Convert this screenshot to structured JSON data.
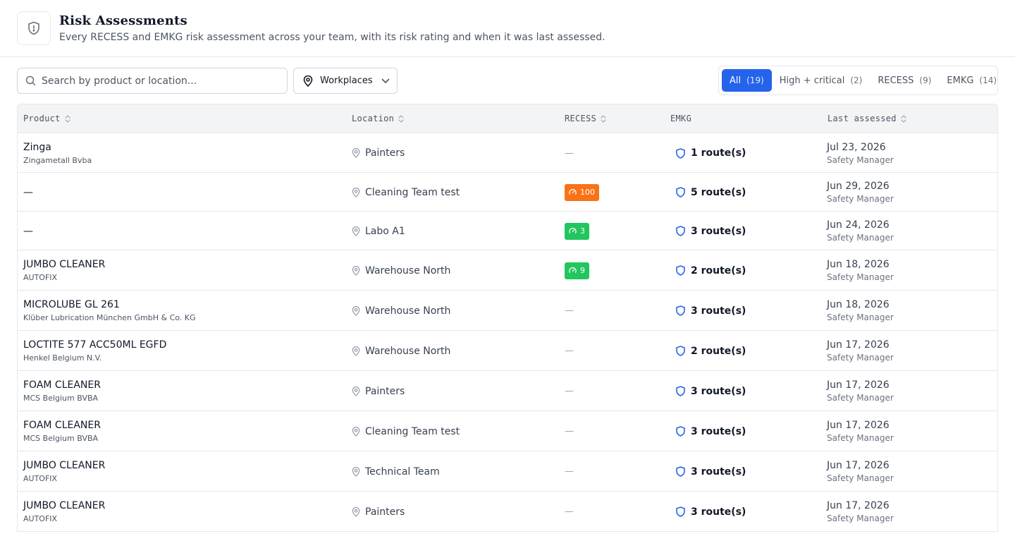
{
  "header": {
    "title": "Risk Assessments",
    "subtitle": "Every RECESS and EMKG risk assessment across your team, with its risk rating and when it was last assessed.",
    "icon": "shield-icon"
  },
  "toolbar": {
    "search_placeholder": "Search by product or location...",
    "workplaces_label": "Workplaces",
    "filters": [
      {
        "label": "All",
        "count": "(19)",
        "active": true
      },
      {
        "label": "High + critical",
        "count": "(2)",
        "active": false
      },
      {
        "label": "RECESS",
        "count": "(9)",
        "active": false
      },
      {
        "label": "EMKG",
        "count": "(14)",
        "active": false
      }
    ]
  },
  "table": {
    "columns": [
      "Product",
      "Location",
      "RECESS",
      "EMKG",
      "Last assessed"
    ],
    "rows": [
      {
        "product": "Zinga",
        "manufacturer": "Zingametall Bvba",
        "location": "Painters",
        "recess": null,
        "recess_color": null,
        "emkg": "1 route(s)",
        "date": "Jul 23, 2026",
        "assessor": "Safety Manager"
      },
      {
        "product": "—",
        "manufacturer": "",
        "location": "Cleaning Team test",
        "recess": "100",
        "recess_color": "#f97316",
        "emkg": "5 route(s)",
        "date": "Jun 29, 2026",
        "assessor": "Safety Manager"
      },
      {
        "product": "—",
        "manufacturer": "",
        "location": "Labo A1",
        "recess": "3",
        "recess_color": "#22c55e",
        "emkg": "3 route(s)",
        "date": "Jun 24, 2026",
        "assessor": "Safety Manager"
      },
      {
        "product": "JUMBO CLEANER",
        "manufacturer": "AUTOFIX",
        "location": "Warehouse North",
        "recess": "9",
        "recess_color": "#22c55e",
        "emkg": "2 route(s)",
        "date": "Jun 18, 2026",
        "assessor": "Safety Manager"
      },
      {
        "product": "MICROLUBE GL 261",
        "manufacturer": "Klüber Lubrication München GmbH & Co. KG",
        "location": "Warehouse North",
        "recess": null,
        "recess_color": null,
        "emkg": "3 route(s)",
        "date": "Jun 18, 2026",
        "assessor": "Safety Manager"
      },
      {
        "product": "LOCTITE 577 ACC50ML EGFD",
        "manufacturer": "Henkel Belgium N.V.",
        "location": "Warehouse North",
        "recess": null,
        "recess_color": null,
        "emkg": "2 route(s)",
        "date": "Jun 17, 2026",
        "assessor": "Safety Manager"
      },
      {
        "product": "FOAM CLEANER",
        "manufacturer": "MCS Belgium BVBA",
        "location": "Painters",
        "recess": null,
        "recess_color": null,
        "emkg": "3 route(s)",
        "date": "Jun 17, 2026",
        "assessor": "Safety Manager"
      },
      {
        "product": "FOAM CLEANER",
        "manufacturer": "MCS Belgium BVBA",
        "location": "Cleaning Team test",
        "recess": null,
        "recess_color": null,
        "emkg": "3 route(s)",
        "date": "Jun 17, 2026",
        "assessor": "Safety Manager"
      },
      {
        "product": "JUMBO CLEANER",
        "manufacturer": "AUTOFIX",
        "location": "Technical Team",
        "recess": null,
        "recess_color": null,
        "emkg": "3 route(s)",
        "date": "Jun 17, 2026",
        "assessor": "Safety Manager"
      },
      {
        "product": "JUMBO CLEANER",
        "manufacturer": "AUTOFIX",
        "location": "Painters",
        "recess": null,
        "recess_color": null,
        "emkg": "3 route(s)",
        "date": "Jun 17, 2026",
        "assessor": "Safety Manager"
      }
    ],
    "empty_dash": "—"
  },
  "colors": {
    "accent": "#2563eb",
    "emkg_shield": "#2563eb",
    "badge_orange": "#f97316",
    "badge_green": "#22c55e"
  }
}
